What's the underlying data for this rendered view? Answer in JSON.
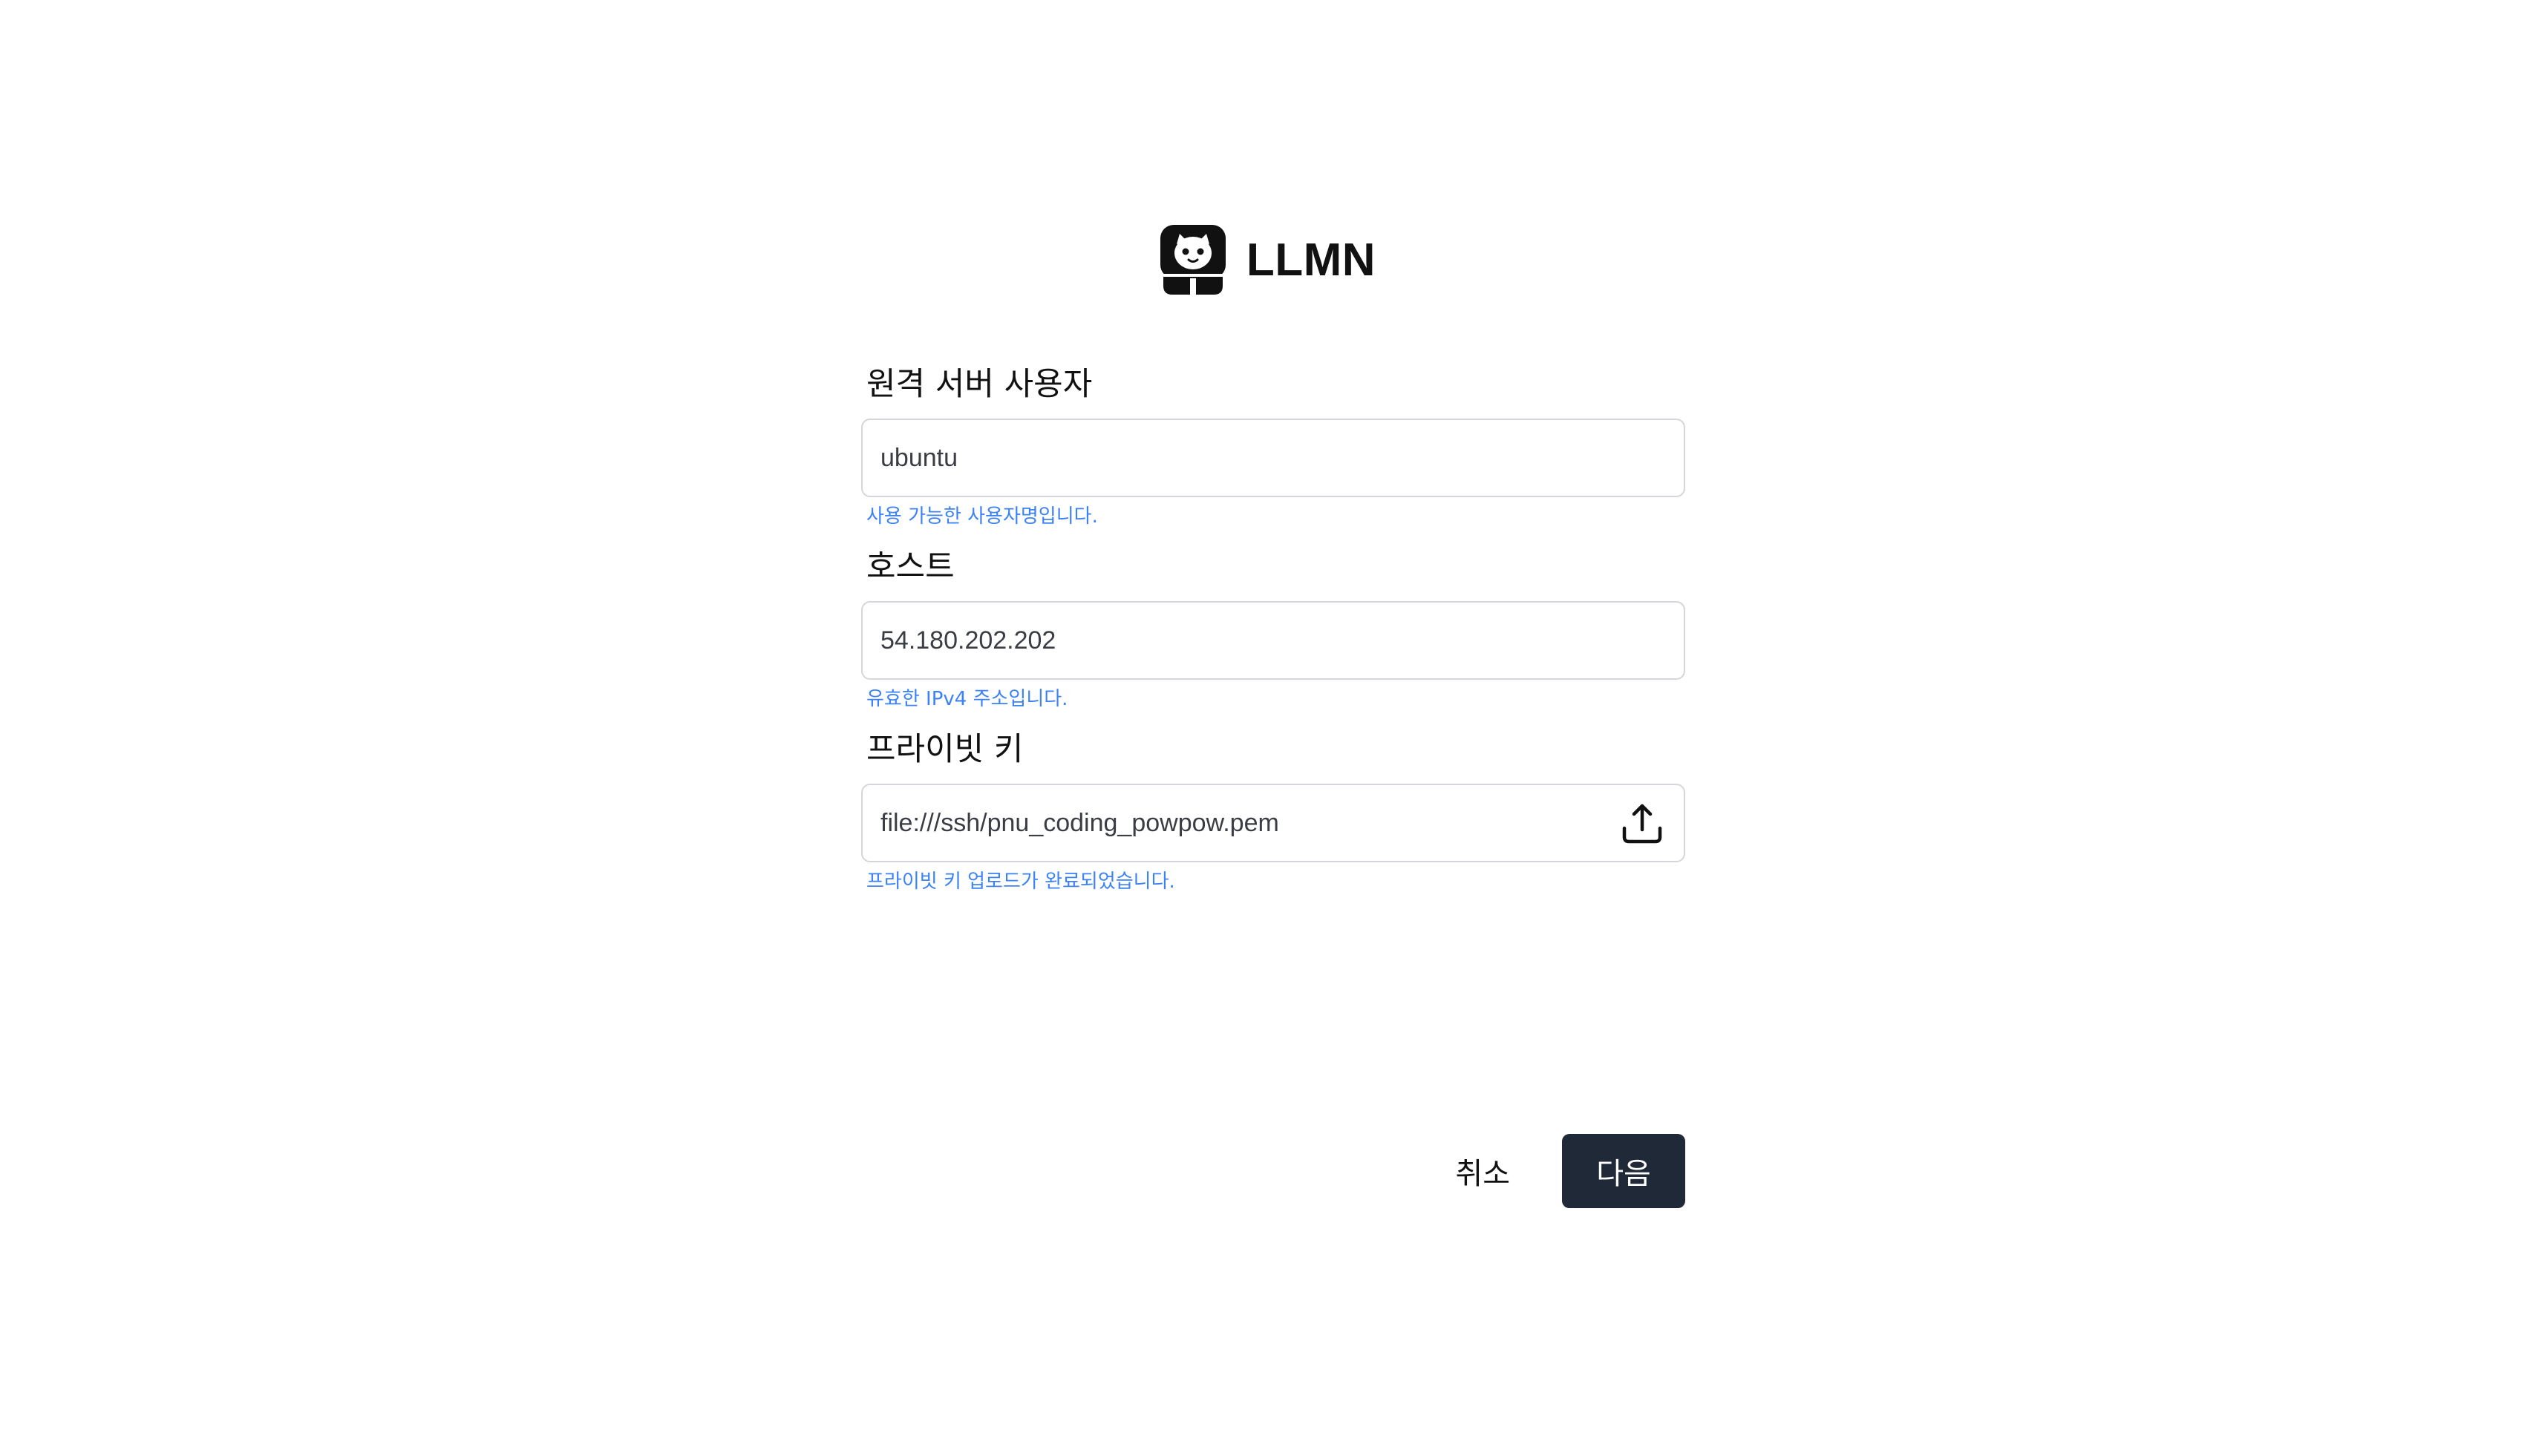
{
  "app": {
    "brand_name": "LLMN",
    "logo_icon": "cat-face-logo-icon"
  },
  "form": {
    "fields": [
      {
        "label": "원격 서버 사용자",
        "value": "ubuntu",
        "help": "사용 가능한 사용자명입니다."
      },
      {
        "label": "호스트",
        "value": "54.180.202.202",
        "help": "유효한 IPv4 주소입니다."
      },
      {
        "label": "프라이빗 키",
        "value": "file:///ssh/pnu_coding_powpow.pem",
        "help": "프라이빗 키 업로드가 완료되었습니다.",
        "action_icon": "upload-icon"
      }
    ]
  },
  "actions": {
    "cancel_label": "취소",
    "next_label": "다음"
  },
  "colors": {
    "primary_button": "#1f2937",
    "help_text": "#3b82f6",
    "input_border": "#d4d6db"
  }
}
